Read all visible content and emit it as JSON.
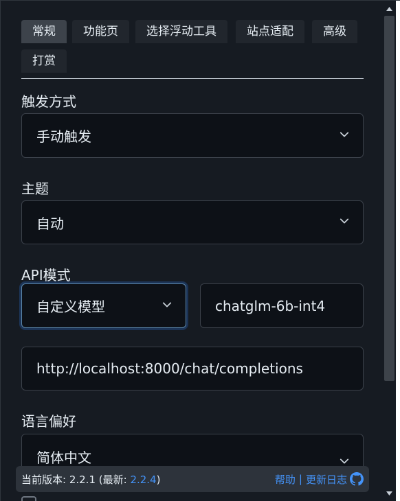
{
  "tabs": [
    {
      "label": "常规",
      "active": true
    },
    {
      "label": "功能页",
      "active": false
    },
    {
      "label": "选择浮动工具",
      "active": false
    },
    {
      "label": "站点适配",
      "active": false
    },
    {
      "label": "高级",
      "active": false
    },
    {
      "label": "打赏",
      "active": false
    }
  ],
  "trigger": {
    "label": "触发方式",
    "value": "手动触发"
  },
  "theme": {
    "label": "主题",
    "value": "自动"
  },
  "api": {
    "label": "API模式",
    "mode_value": "自定义模型",
    "model_name": "chatglm-6b-int4",
    "endpoint": "http://localhost:8000/chat/completions"
  },
  "language": {
    "label": "语言偏好",
    "value": "简体中文"
  },
  "footer": {
    "version_prefix": "当前版本: 2.2.1 (最新: ",
    "latest_version": "2.2.4",
    "version_suffix": ")",
    "help_label": "帮助",
    "separator": "|",
    "changelog_label": "更新日志"
  },
  "colors": {
    "accent": "#4493f8",
    "background": "#161b22",
    "input_bg": "#0d1117"
  },
  "icons": {
    "footer": "github-icon",
    "select": "chevron-down-icon"
  }
}
